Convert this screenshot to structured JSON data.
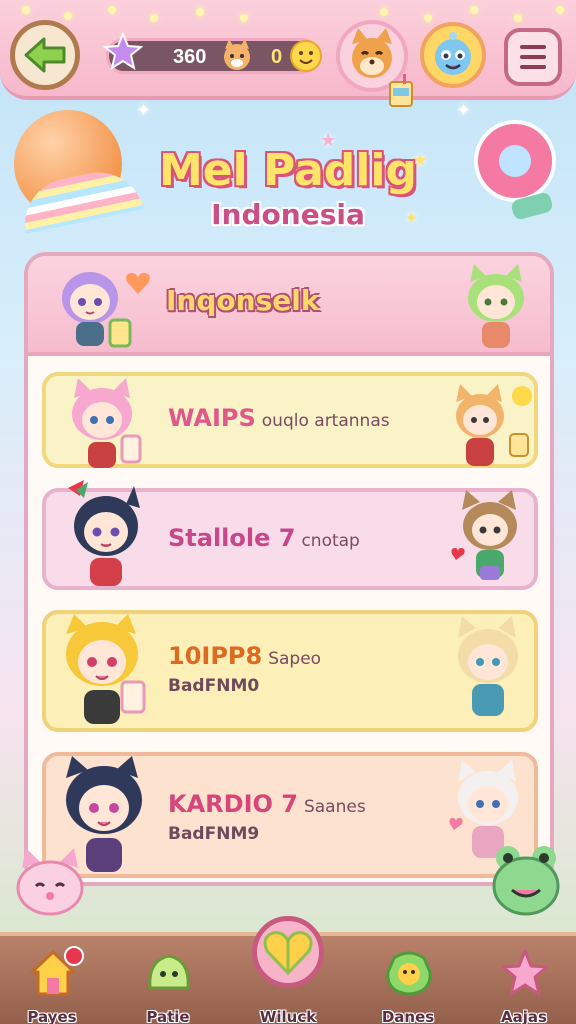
{
  "header": {
    "currency_primary": "360",
    "currency_secondary": "0"
  },
  "title": {
    "line1": "Mel Padlig",
    "line2": "Indonesia"
  },
  "panel": {
    "header_label": "Inqonselk"
  },
  "cards": [
    {
      "title": "WAIPS",
      "subtitle": "ouqlo artannas",
      "line2": "",
      "bg": "#fbf3c8",
      "border": "#f1d77d",
      "title_color": "#e0578a"
    },
    {
      "title": "Stallole 7",
      "subtitle": "cnotap",
      "line2": "",
      "bg": "#f8dcea",
      "border": "#e8b2cc",
      "title_color": "#c8468a"
    },
    {
      "title": "10IPP8",
      "subtitle": "Sapeo",
      "line2": "BadFNM0",
      "bg": "#fcefb8",
      "border": "#f0d27a",
      "title_color": "#df6a1f"
    },
    {
      "title": "KARDIO 7",
      "subtitle": "Saanes",
      "line2": "BadFNM9",
      "bg": "#fde2cf",
      "border": "#f0b99a",
      "title_color": "#d8457a"
    }
  ],
  "bottom_nav": [
    {
      "label": "Payes",
      "icon": "house-icon"
    },
    {
      "label": "Patie",
      "icon": "slime-icon"
    },
    {
      "label": "Wiluck",
      "icon": "heart-puzzle-icon"
    },
    {
      "label": "Danes",
      "icon": "frog-icon"
    },
    {
      "label": "Aajas",
      "icon": "star-icon"
    }
  ],
  "colors": {
    "accent_pink": "#f47aa3",
    "top_bar": "#f7b8cb",
    "nav_bar": "#94604c"
  }
}
